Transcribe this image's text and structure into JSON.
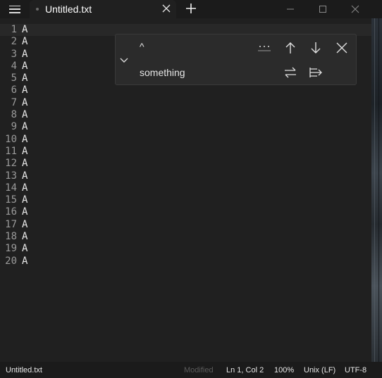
{
  "tab": {
    "title": "Untitled.txt"
  },
  "editor": {
    "lines": [
      {
        "num": "1",
        "text": "A"
      },
      {
        "num": "2",
        "text": "A"
      },
      {
        "num": "3",
        "text": "A"
      },
      {
        "num": "4",
        "text": "A"
      },
      {
        "num": "5",
        "text": "A"
      },
      {
        "num": "6",
        "text": "A"
      },
      {
        "num": "7",
        "text": "A"
      },
      {
        "num": "8",
        "text": "A"
      },
      {
        "num": "9",
        "text": "A"
      },
      {
        "num": "10",
        "text": "A"
      },
      {
        "num": "11",
        "text": "A"
      },
      {
        "num": "12",
        "text": "A"
      },
      {
        "num": "13",
        "text": "A"
      },
      {
        "num": "14",
        "text": "A"
      },
      {
        "num": "15",
        "text": "A"
      },
      {
        "num": "16",
        "text": "A"
      },
      {
        "num": "17",
        "text": "A"
      },
      {
        "num": "18",
        "text": "A"
      },
      {
        "num": "19",
        "text": "A"
      },
      {
        "num": "20",
        "text": "A"
      }
    ]
  },
  "find": {
    "search_value": "^",
    "replace_value": "something"
  },
  "status": {
    "filename": "Untitled.txt",
    "modified": "Modified",
    "position": "Ln 1, Col 2",
    "zoom": "100%",
    "line_ending": "Unix (LF)",
    "encoding": "UTF-8"
  },
  "icons": {
    "menu": "hamburger-icon",
    "tab_close": "close-icon",
    "new_tab": "plus-icon",
    "minimize": "minimize-icon",
    "maximize": "maximize-icon",
    "close": "close-icon",
    "toggle": "chevron-down-icon",
    "options": "more-options-icon",
    "prev": "arrow-up-icon",
    "next": "arrow-down-icon",
    "find_close": "close-icon",
    "replace": "replace-icon",
    "replace_all": "replace-all-icon"
  }
}
